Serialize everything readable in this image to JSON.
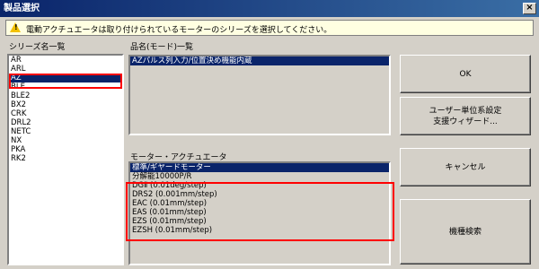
{
  "window": {
    "title": "製品選択",
    "close_glyph": "×"
  },
  "info": {
    "icon": "warning-icon",
    "message": "電動アクチュエータは取り付けられているモーターのシリーズを選択してください。"
  },
  "series": {
    "label": "シリーズ名一覧",
    "items": [
      "AR",
      "ARL",
      "AZ",
      "BLE",
      "BLE2",
      "BX2",
      "CRK",
      "DRL2",
      "NETC",
      "NX",
      "PKA",
      "RK2"
    ],
    "selected": "AZ"
  },
  "product": {
    "label": "品名(モード)一覧",
    "items": [
      "AZパルス列入力/位置決め機能内蔵"
    ]
  },
  "motor": {
    "label": "モーター・アクチュエータ",
    "items": [
      "標準/ギヤードモーター",
      "分解能10000P/R",
      "DGⅡ (0.01deg/step)",
      "DRS2 (0.001mm/step)",
      "EAC (0.01mm/step)",
      "EAS (0.01mm/step)",
      "EZS (0.01mm/step)",
      "EZSH (0.01mm/step)"
    ]
  },
  "buttons": {
    "ok": "OK",
    "wizard_line1": "ユーザー単位系設定",
    "wizard_line2": "支援ウィザード...",
    "cancel": "キャンセル",
    "search": "機種検索"
  },
  "colors": {
    "selection": "#0a246a",
    "highlight_box": "#ff0000",
    "info_bg": "#ffffe1"
  }
}
